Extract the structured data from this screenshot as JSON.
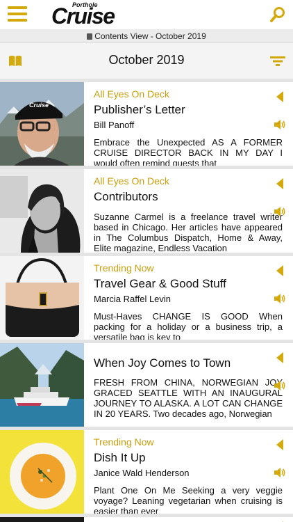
{
  "header": {
    "logo_small": "Porthole",
    "logo_big": "Cruise"
  },
  "subheader": {
    "view_label": "Contents View - October 2019"
  },
  "issue": {
    "month": "October 2019"
  },
  "colors": {
    "accent": "#d4a90b",
    "category": "#c9a00c"
  },
  "articles": [
    {
      "category": "All Eyes On Deck",
      "title": "Publisher’s Letter",
      "author": "Bill Panoff",
      "excerpt": "Embrace the Unexpected AS A FORMER CRUISE DIRECTOR BACK IN MY DAY I would often remind guests that",
      "thumb": "man-in-cruise-cap-glacier"
    },
    {
      "category": "All Eyes On Deck",
      "title": "Contributors",
      "author": "",
      "excerpt": "Suzanne Carmel is a freelance travel writer based in Chicago. Her articles have appeared in The Columbus Dispatch, Home & Away, Elite magazine, Endless Vacation",
      "thumb": "woman-portrait-bw"
    },
    {
      "category": "Trending Now",
      "title": "Travel Gear & Good Stuff",
      "author": "Marcia Raffel Levin",
      "excerpt": "Must-Haves CHANGE IS GOOD When packing for a holiday or a business trip, a versatile bag is key to",
      "thumb": "black-leather-bag"
    },
    {
      "category": "",
      "title": "When Joy Comes to Town",
      "author": "",
      "excerpt": "FRESH FROM CHINA, NORWEGIAN JOY GRACED SEATTLE WITH AN INAUGURAL JOURNEY TO ALASKA. A LOT CAN CHANGE IN 20 YEARS. Two decades ago, Norwegian",
      "thumb": "ship-in-fjord"
    },
    {
      "category": "Trending Now",
      "title": "Dish It Up",
      "author": "Janice Wald Henderson",
      "excerpt": "Plant One On Me Seeking a very veggie voyage? Leaning vegetarian when cruising is easier than ever",
      "thumb": "soup-bowl"
    }
  ]
}
